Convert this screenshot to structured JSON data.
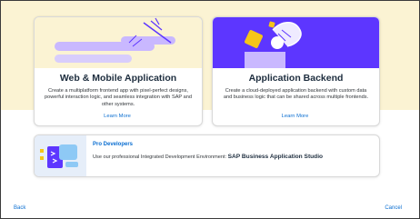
{
  "cards": [
    {
      "title": "Web & Mobile Application",
      "description": "Create a multiplatform frontend app with pixel-perfect designs, powerful interaction logic, and seamless integration with SAP and other systems.",
      "link": "Learn More"
    },
    {
      "title": "Application Backend",
      "description": "Create a cloud-deployed application backend with custom data and business logic that can be shared across multiple frontends.",
      "link": "Learn More"
    }
  ],
  "pro": {
    "title": "Pro Developers",
    "description_prefix": "Use our professional Integrated Development Environment:",
    "description_strong": "SAP Business Application Studio"
  },
  "footer": {
    "back": "Back",
    "cancel": "Cancel"
  },
  "colors": {
    "band": "#fbf3d3",
    "link": "#0a6ed1",
    "purple": "#5d36ff",
    "lavender": "#c9b8ff",
    "yellow": "#f5c518"
  }
}
